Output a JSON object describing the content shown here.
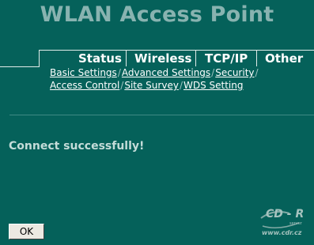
{
  "header": {
    "title": "WLAN Access Point"
  },
  "tabs": [
    {
      "label": "Status"
    },
    {
      "label": "Wireless"
    },
    {
      "label": "TCP/IP"
    },
    {
      "label": "Other"
    }
  ],
  "subnav": {
    "row1": [
      "Basic Settings",
      "Advanced Settings",
      "Security"
    ],
    "row2": [
      "Access Control",
      "Site Survey",
      "WDS Setting"
    ]
  },
  "main": {
    "message": "Connect successfully!",
    "ok_label": "OK"
  },
  "watermark": {
    "brand": "CD - R",
    "small": "server",
    "url": "www.cdr.cz"
  },
  "colors": {
    "background": "#05615a",
    "title": "#88b3b0",
    "message": "#c4dcd9"
  }
}
